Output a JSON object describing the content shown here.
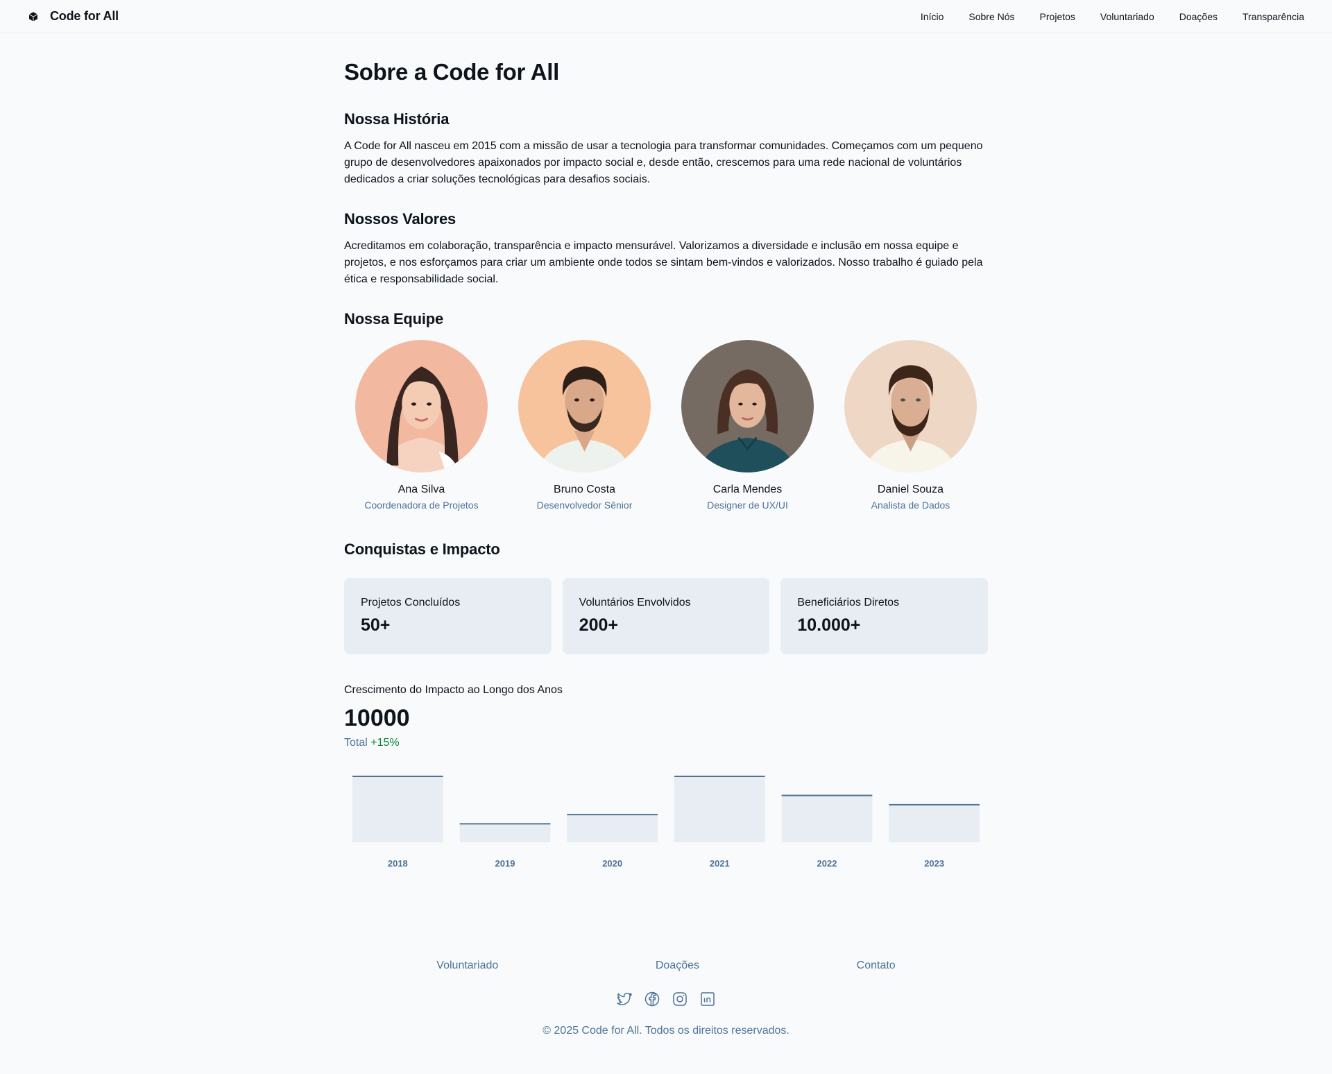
{
  "header": {
    "brand": "Code for All",
    "nav": [
      "Início",
      "Sobre Nós",
      "Projetos",
      "Voluntariado",
      "Doações",
      "Transparência"
    ]
  },
  "main": {
    "title": "Sobre a Code for All",
    "history": {
      "title": "Nossa História",
      "text": "A Code for All nasceu em 2015 com a missão de usar a tecnologia para transformar comunidades. Começamos com um pequeno grupo de desenvolvedores apaixonados por impacto social e, desde então, crescemos para uma rede nacional de voluntários dedicados a criar soluções tecnológicas para desafios sociais."
    },
    "values": {
      "title": "Nossos Valores",
      "text": "Acreditamos em colaboração, transparência e impacto mensurável. Valorizamos a diversidade e inclusão em nossa equipe e projetos, e nos esforçamos para criar um ambiente onde todos se sintam bem-vindos e valorizados. Nosso trabalho é guiado pela ética e responsabilidade social."
    },
    "team": {
      "title": "Nossa Equipe",
      "members": [
        {
          "name": "Ana Silva",
          "role": "Coordenadora de Projetos"
        },
        {
          "name": "Bruno Costa",
          "role": "Desenvolvedor Sênior"
        },
        {
          "name": "Carla Mendes",
          "role": "Designer de UX/UI"
        },
        {
          "name": "Daniel Souza",
          "role": "Analista de Dados"
        }
      ]
    },
    "impact": {
      "title": "Conquistas e Impacto",
      "stats": [
        {
          "label": "Projetos Concluídos",
          "value": "50+"
        },
        {
          "label": "Voluntários Envolvidos",
          "value": "200+"
        },
        {
          "label": "Beneficiários Diretos",
          "value": "10.000+"
        }
      ],
      "chart_label": "Crescimento do Impacto ao Longo dos Anos",
      "chart_value": "10000",
      "chart_sub_label": "Total",
      "chart_sub_change": "+15%"
    }
  },
  "chart_data": {
    "type": "bar",
    "categories": [
      "2018",
      "2019",
      "2020",
      "2021",
      "2022",
      "2023"
    ],
    "values": [
      100,
      28,
      42,
      100,
      71,
      57
    ],
    "title": "Crescimento do Impacto ao Longo dos Anos",
    "xlabel": "",
    "ylabel": "",
    "ylim": [
      0,
      100
    ],
    "colors": {
      "fill": "#e7edf3",
      "stroke": "#4e7397",
      "label": "#4e7397"
    }
  },
  "footer": {
    "links": [
      "Voluntariado",
      "Doações",
      "Contato"
    ],
    "social": [
      "twitter-icon",
      "facebook-icon",
      "instagram-icon",
      "linkedin-icon"
    ],
    "copyright": "© 2025 Code for All. Todos os direitos reservados."
  },
  "colors": {
    "background": "#f8fafc",
    "text": "#0e141b",
    "muted": "#4e7397",
    "card": "#e7edf3",
    "positive": "#078838"
  }
}
